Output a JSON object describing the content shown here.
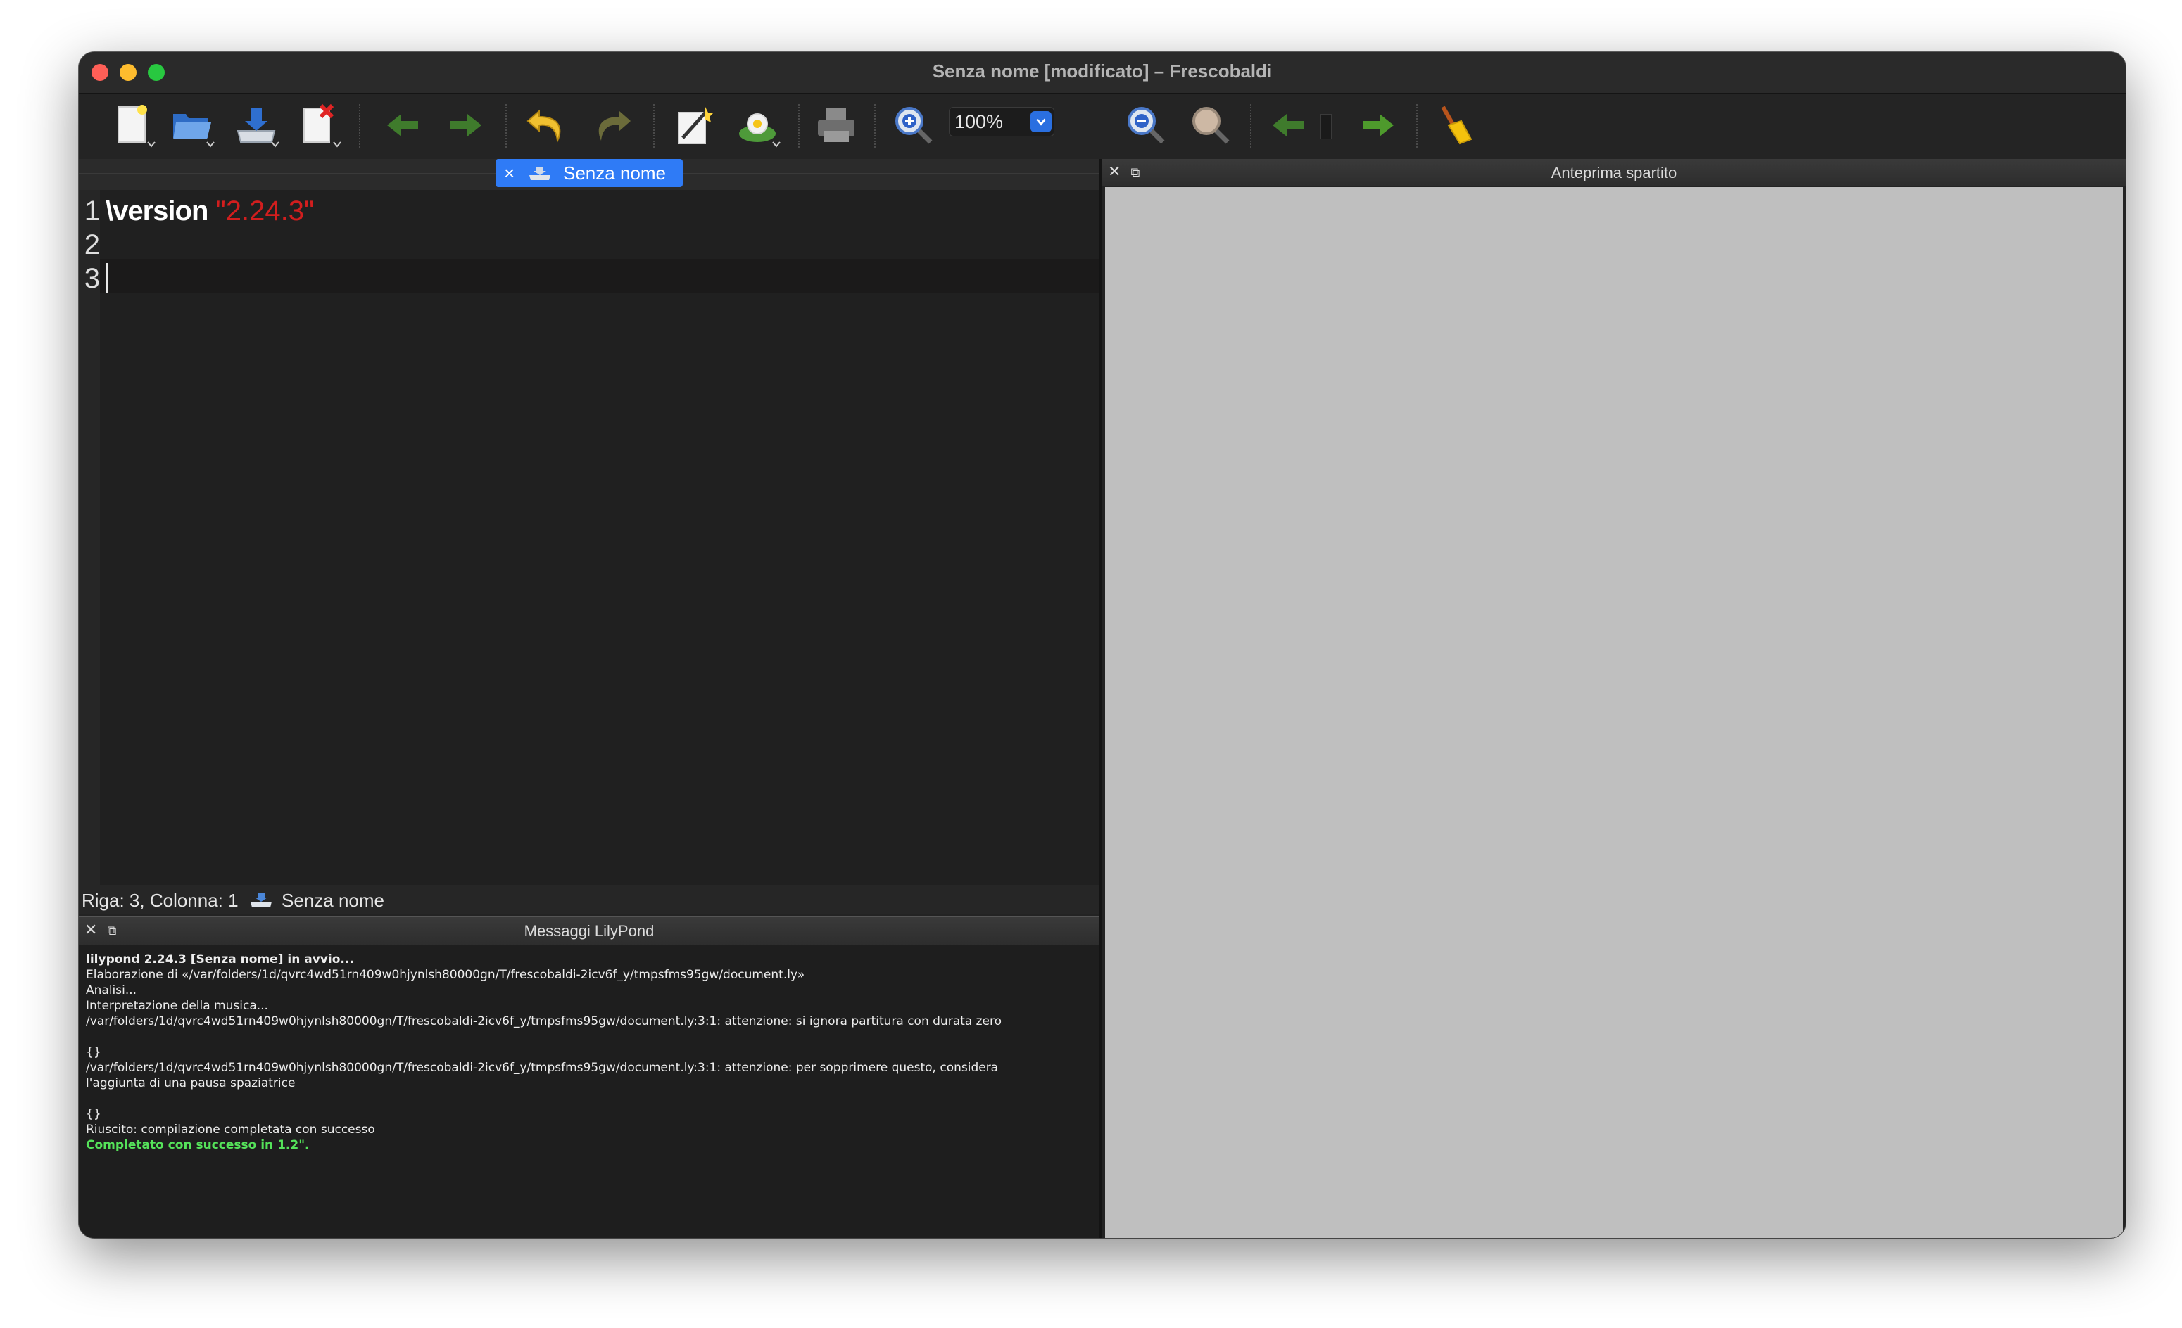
{
  "window": {
    "title": "Senza nome [modificato] – Frescobaldi"
  },
  "toolbar": {
    "buttons": [
      {
        "name": "new-document",
        "icon": "new-document-icon"
      },
      {
        "name": "open",
        "icon": "folder-open-icon"
      },
      {
        "name": "save",
        "icon": "save-icon"
      },
      {
        "name": "close-document",
        "icon": "close-document-icon"
      },
      {
        "name": "back",
        "icon": "arrow-left-icon"
      },
      {
        "name": "forward",
        "icon": "arrow-right-icon"
      },
      {
        "name": "undo",
        "icon": "undo-icon"
      },
      {
        "name": "redo",
        "icon": "redo-icon"
      },
      {
        "name": "snippets",
        "icon": "edit-wand-icon"
      },
      {
        "name": "lilypond-engrave",
        "icon": "lily-icon"
      },
      {
        "name": "print",
        "icon": "print-icon"
      },
      {
        "name": "zoom-in",
        "icon": "zoom-in-icon"
      },
      {
        "name": "zoom-out",
        "icon": "zoom-out-icon"
      },
      {
        "name": "zoom-original",
        "icon": "magnifier-icon"
      },
      {
        "name": "previous-page",
        "icon": "arrow-left-icon"
      },
      {
        "name": "next-page",
        "icon": "arrow-right-icon"
      },
      {
        "name": "clear-log",
        "icon": "broom-icon"
      }
    ],
    "zoom_value": "100%"
  },
  "editor": {
    "tab_label": "Senza nome",
    "tab_close": "×",
    "lines": [
      {
        "number": "1",
        "keyword": "\\version",
        "string": "\"2.24.3\""
      },
      {
        "number": "2",
        "keyword": "",
        "string": ""
      },
      {
        "number": "3",
        "keyword": "",
        "string": ""
      }
    ]
  },
  "status": {
    "position": "Riga: 3, Colonna: 1",
    "document": "Senza nome"
  },
  "messages_panel": {
    "title": "Messaggi LilyPond",
    "lines": [
      {
        "text": "lilypond 2.24.3 [Senza nome] in avvio...",
        "style": "bold"
      },
      {
        "text": "Elaborazione di «/var/folders/1d/qvrc4wd51rn409w0hjynlsh80000gn/T/frescobaldi-2icv6f_y/tmpsfms95gw/document.ly»",
        "style": "normal"
      },
      {
        "text": "Analisi...",
        "style": "normal"
      },
      {
        "text": "Interpretazione della musica...",
        "style": "normal"
      },
      {
        "text": "/var/folders/1d/qvrc4wd51rn409w0hjynlsh80000gn/T/frescobaldi-2icv6f_y/tmpsfms95gw/document.ly:3:1: attenzione: si ignora partitura con durata zero",
        "style": "normal"
      },
      {
        "text": "",
        "style": "normal"
      },
      {
        "text": "{}",
        "style": "normal"
      },
      {
        "text": "/var/folders/1d/qvrc4wd51rn409w0hjynlsh80000gn/T/frescobaldi-2icv6f_y/tmpsfms95gw/document.ly:3:1: attenzione: per sopprimere questo, considera",
        "style": "normal"
      },
      {
        "text": "l'aggiunta di una pausa spaziatrice",
        "style": "normal"
      },
      {
        "text": "",
        "style": "normal"
      },
      {
        "text": "{}",
        "style": "normal"
      },
      {
        "text": "Riuscito: compilazione completata con successo",
        "style": "normal"
      },
      {
        "text": "Completato con successo in 1.2\".",
        "style": "ok"
      }
    ]
  },
  "preview_panel": {
    "title": "Anteprima spartito"
  },
  "dock_buttons": {
    "close": "✕",
    "float": "⧉"
  },
  "colors": {
    "tab_accent": "#2f7bf6",
    "string": "#d21e1e",
    "success": "#55e35a",
    "preview_bg": "#bfbfbf"
  }
}
